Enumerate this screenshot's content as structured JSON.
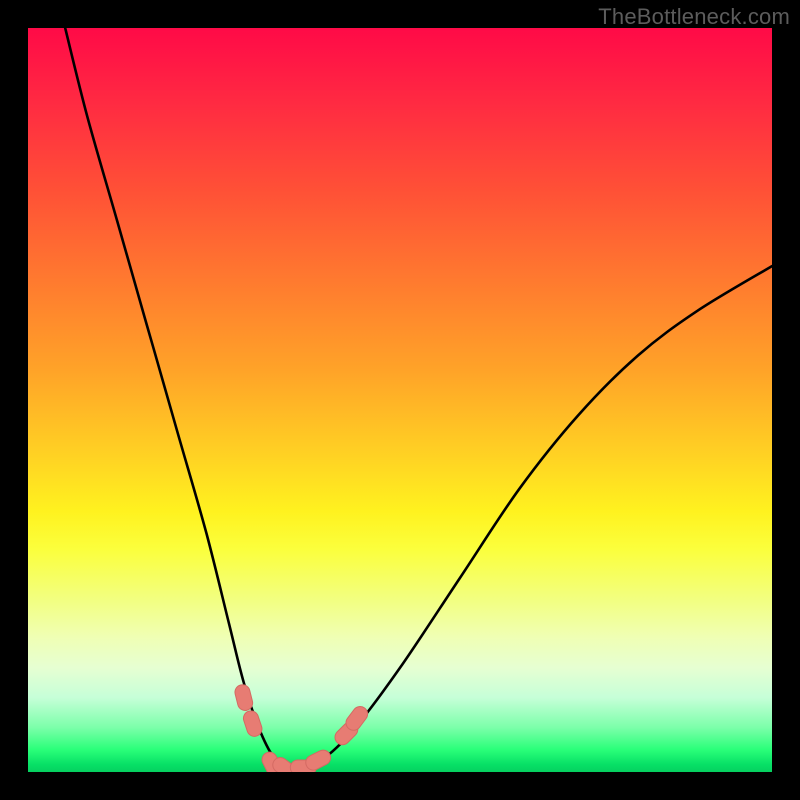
{
  "watermark": {
    "text": "TheBottleneck.com"
  },
  "colors": {
    "background": "#000000",
    "curve": "#000000",
    "bead_fill": "#e77c73",
    "bead_outline": "#d46a63"
  },
  "chart_data": {
    "type": "line",
    "title": "",
    "xlabel": "",
    "ylabel": "",
    "xlim": [
      0,
      100
    ],
    "ylim": [
      0,
      100
    ],
    "grid": false,
    "legend": false,
    "series": [
      {
        "name": "bottleneck-curve",
        "x": [
          5,
          8,
          12,
          16,
          20,
          24,
          27,
          29,
          31,
          33,
          35,
          37,
          40,
          44,
          50,
          58,
          66,
          74,
          82,
          90,
          100
        ],
        "y": [
          100,
          88,
          74,
          60,
          46,
          32,
          20,
          12,
          6,
          2,
          0.5,
          0.5,
          2,
          6,
          14,
          26,
          38,
          48,
          56,
          62,
          68
        ]
      }
    ],
    "markers": [
      {
        "name": "bead-left-upper",
        "x": 29.0,
        "y": 10.0
      },
      {
        "name": "bead-left-lower",
        "x": 30.2,
        "y": 6.5
      },
      {
        "name": "bead-bottom-1",
        "x": 32.8,
        "y": 1.0
      },
      {
        "name": "bead-bottom-2",
        "x": 34.5,
        "y": 0.5
      },
      {
        "name": "bead-bottom-3",
        "x": 37.0,
        "y": 0.6
      },
      {
        "name": "bead-bottom-4",
        "x": 39.0,
        "y": 1.6
      },
      {
        "name": "bead-right-lower",
        "x": 42.8,
        "y": 5.2
      },
      {
        "name": "bead-right-upper",
        "x": 44.2,
        "y": 7.2
      }
    ]
  }
}
